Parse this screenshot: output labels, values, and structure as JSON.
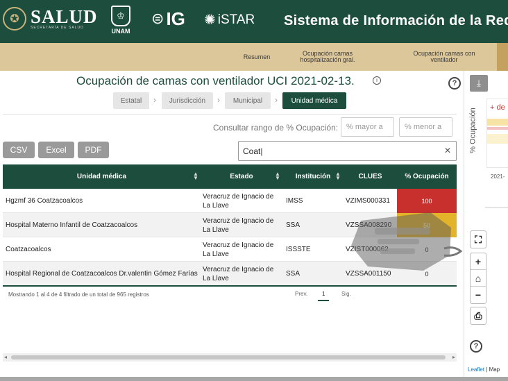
{
  "header": {
    "salud": {
      "title": "SALUD",
      "subtitle": "SECRETARÍA DE SALUD"
    },
    "unam": "UNAM",
    "ig": "IG",
    "istar": "iSTAR",
    "system_title": "Sistema de Información de la Red"
  },
  "nav": {
    "tabs": [
      {
        "label": "Resumen",
        "active": false
      },
      {
        "label": "Ocupación camas\nhospitalización gral.",
        "active": false
      },
      {
        "label": "Ocupación camas con\nventilador",
        "active": false
      }
    ]
  },
  "page": {
    "title": "Ocupación de camas con ventilador UCI 2021-02-13.",
    "info_icon": "info-icon",
    "help_icon": "help-icon"
  },
  "breadcrumb": {
    "items": [
      "Estatal",
      "Jurisdicción",
      "Municipal",
      "Unidad médica"
    ],
    "active_index": 3
  },
  "range": {
    "label": "Consultar rango de % Ocupación:",
    "min_placeholder": "% mayor a",
    "max_placeholder": "% menor a"
  },
  "toolbar": {
    "csv": "CSV",
    "excel": "Excel",
    "pdf": "PDF"
  },
  "search": {
    "value": "Coat"
  },
  "table": {
    "columns": [
      "Unidad médica",
      "Estado",
      "Institución",
      "CLUES",
      "% Ocupación"
    ],
    "rows": [
      {
        "unidad": "Hgzmf 36 Coatzacoalcos",
        "estado": "Veracruz de Ignacio de La Llave",
        "institucion": "IMSS",
        "clues": "VZIMS000331",
        "ocupacion": "100",
        "color": "#c8302d"
      },
      {
        "unidad": "Hospital Materno Infantil de Coatzacoalcos",
        "estado": "Veracruz de Ignacio de La Llave",
        "institucion": "SSA",
        "clues": "VZSSA008290",
        "ocupacion": "50",
        "color": "#e3b42a"
      },
      {
        "unidad": "Coatzacoalcos",
        "estado": "Veracruz de Ignacio de La Llave",
        "institucion": "ISSSTE",
        "clues": "VZIST000062",
        "ocupacion": "0",
        "color": ""
      },
      {
        "unidad": "Hospital Regional de Coatzacoalcos Dr.valentin Gómez Farías",
        "estado": "Veracruz de Ignacio de La Llave",
        "institucion": "SSA",
        "clues": "VZSSA001150",
        "ocupacion": "0",
        "color": ""
      }
    ],
    "info": "Mostrando 1 al 4 de 4 filtrado de un total de 965 registros",
    "pagination": {
      "prev": "Prev.",
      "current": "1",
      "next": "Sig."
    }
  },
  "side": {
    "download_icon": "download-icon",
    "ylabel": "% Ocupación",
    "legend": "+ de",
    "xtick": "2021-",
    "attribution_link": "Leaflet",
    "attribution_sep": " | ",
    "attribution_map": "Map"
  },
  "colors": {
    "brand": "#1d4d3c",
    "nav": "#dcc79b",
    "nav_active": "#c5a15f",
    "high": "#c8302d",
    "medium": "#e3b42a"
  }
}
